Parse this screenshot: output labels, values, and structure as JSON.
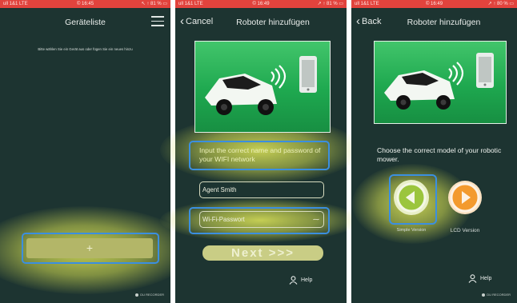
{
  "status_bar": {
    "p1": {
      "left": "ull 1&1 LTE",
      "center": "© 16:45",
      "right": "↖ ↑ 81 % ▭"
    },
    "p2": {
      "left": "ull 1&1 LTE",
      "center": "© 16:49",
      "right": "↗ ↑ 81 % ▭"
    },
    "p3": {
      "left": "ull 1&1 LTE",
      "center": "© 16:49",
      "right": "↗ ↑ 80 % ▭"
    }
  },
  "screen1": {
    "title": "Geräteliste",
    "hint": "Bitte wählen Sie ein Gerät aus oder fügen Sie ein neues hinzu",
    "add_label": "+",
    "recorder": "DU RECORDER"
  },
  "screen2": {
    "back_label": "Cancel",
    "title": "Roboter hinzufügen",
    "instruction": "Input the correct name and password of your WIFI network",
    "name_value": "Agent Smith",
    "password_value": "Wi-Fi-Passwort",
    "next_label": "Next >>>",
    "help_label": "Help"
  },
  "screen3": {
    "back_label": "Back",
    "title": "Roboter hinzufügen",
    "instruction": "Choose the correct model of your robotic mower.",
    "simple_label": "Simple Version",
    "lcd_label": "LCD Version",
    "help_label": "Help",
    "recorder": "DU RECORDER"
  },
  "colors": {
    "background": "#1d3431",
    "status_bar": "#e2433d",
    "highlight_box": "#3b8fe0",
    "highlight_glow": "#e2e95a",
    "hero_green": "#1ea84f",
    "simple_button": "#9bc53d",
    "lcd_button": "#f39a2e"
  },
  "icons": {
    "menu": "hamburger-menu-icon",
    "back": "chevron-left-icon",
    "help": "person-icon",
    "mower": "robot-mower-icon",
    "phone": "smartphone-icon",
    "wifi": "wifi-signal-icon",
    "password_toggle": "eye-icon",
    "play": "play-triangle-icon"
  }
}
